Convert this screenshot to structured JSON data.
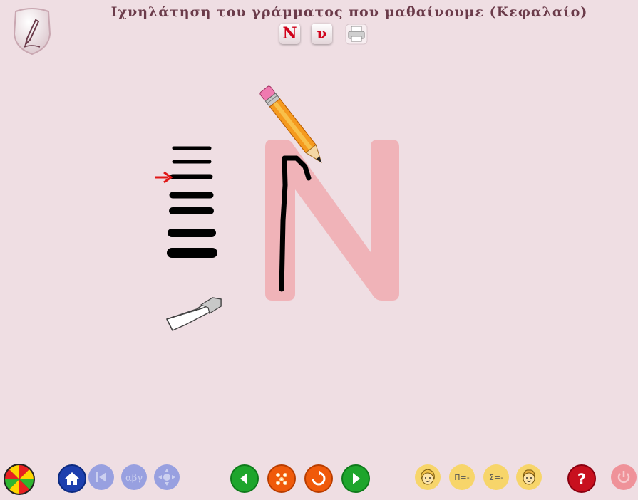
{
  "header": {
    "title": "Ιχνηλάτηση του γράμματος που μαθαίνουμε  (Κεφαλαίο)",
    "uppercase_label": "Ν",
    "lowercase_label": "ν"
  },
  "tracing": {
    "letter": "N",
    "letter_color": "#f0b3b8",
    "stroke_color": "#000000",
    "selected_width_index": 1
  },
  "colors": {
    "background": "#efdee3",
    "title": "#6b3b4a",
    "case_button_text": "#d0021b",
    "nav_blue": "#1d3fae",
    "nav_green": "#1ea52c",
    "nav_orange": "#f05a0a",
    "yellow": "#f7d56a",
    "help_red": "#c8101e"
  },
  "toolbar": {
    "pi_label": "Π=-",
    "sigma_label": "Σ=-"
  },
  "icons": {
    "app": "pencil-shield-icon",
    "print": "printer-icon",
    "menu": "color-wheel-icon",
    "home": "home-icon",
    "first": "first-page-icon",
    "alphabet": "alphabet-icon",
    "navigate": "navigation-pad-icon",
    "prev": "arrow-left-icon",
    "flowers": "flowers-icon",
    "reload": "reload-icon",
    "next": "arrow-right-icon",
    "girl": "girl-face-icon",
    "boy": "boy-face-icon",
    "help": "help-icon",
    "exit": "power-icon"
  }
}
